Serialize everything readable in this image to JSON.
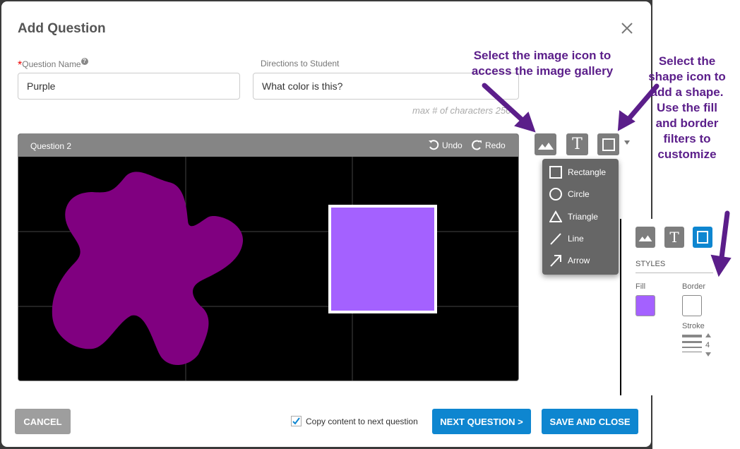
{
  "dialog": {
    "title": "Add Question",
    "close_icon": "close-icon"
  },
  "form": {
    "question_name_label": "Question Name",
    "required_marker": "*",
    "help_icon": "?",
    "question_name_value": "Purple",
    "directions_label": "Directions to Student",
    "directions_value": "What color is this?",
    "max_chars_text": "max # of characters 250"
  },
  "canvas": {
    "title": "Question 2",
    "undo_label": "Undo",
    "redo_label": "Redo",
    "background_color": "#000000",
    "blob_color": "#800080",
    "rect_fill_color": "#a461ff",
    "rect_border_color": "#ffffff"
  },
  "toolbar": {
    "image_icon": "image-icon",
    "text_icon": "T",
    "shape_icon": "square-icon"
  },
  "shape_menu": {
    "items": [
      {
        "label": "Rectangle",
        "icon": "rectangle-icon"
      },
      {
        "label": "Circle",
        "icon": "circle-icon"
      },
      {
        "label": "Triangle",
        "icon": "triangle-icon"
      },
      {
        "label": "Line",
        "icon": "line-icon"
      },
      {
        "label": "Arrow",
        "icon": "arrow-icon"
      }
    ]
  },
  "styles_panel": {
    "title": "STYLES",
    "fill_label": "Fill",
    "fill_color": "#a461ff",
    "border_label": "Border",
    "border_color": "#ffffff",
    "stroke_label": "Stroke",
    "stroke_value": "4"
  },
  "annotations": {
    "image_hint": "Select the image icon to access the image gallery",
    "shape_hint": "Select the shape icon to add a shape. Use the fill and border filters to customize"
  },
  "footer": {
    "cancel_label": "CANCEL",
    "copy_content_label": "Copy content to next question",
    "copy_content_checked": true,
    "next_label": "NEXT QUESTION >",
    "save_label": "SAVE AND CLOSE"
  },
  "colors": {
    "primary": "#0e86d0",
    "cancel": "#9e9e9e",
    "annotation": "#5b1e8a"
  }
}
